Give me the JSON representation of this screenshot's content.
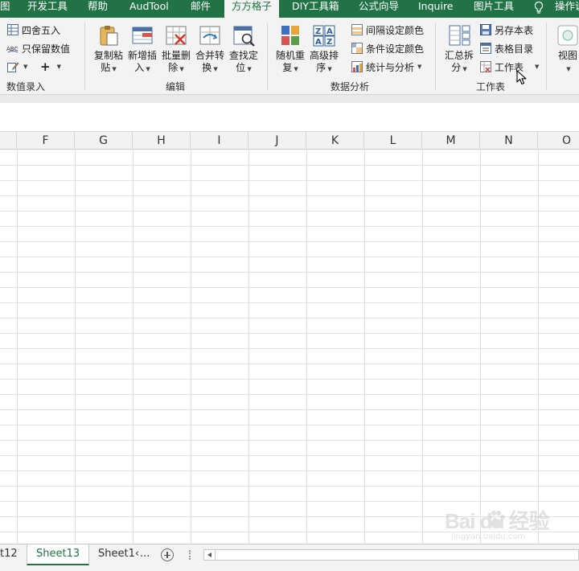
{
  "tabs": [
    {
      "label": "图"
    },
    {
      "label": "开发工具"
    },
    {
      "label": "帮助"
    },
    {
      "label": "AudTool"
    },
    {
      "label": "邮件"
    },
    {
      "label": "方方格子"
    },
    {
      "label": "DIY工具箱"
    },
    {
      "label": "公式向导"
    },
    {
      "label": "Inquire"
    },
    {
      "label": "图片工具"
    },
    {
      "label": "操作说"
    }
  ],
  "ribbon": {
    "input_group": {
      "label": "数值录入",
      "round": "四舍五入",
      "keep_values": "只保留数值",
      "plus": "+"
    },
    "edit_group": {
      "label": "编辑",
      "buttons": [
        {
          "line1": "复制粘",
          "line2": "贴"
        },
        {
          "line1": "新增插",
          "line2": "入"
        },
        {
          "line1": "批量删",
          "line2": "除"
        },
        {
          "line1": "合并转",
          "line2": "换"
        },
        {
          "line1": "查找定",
          "line2": "位"
        }
      ]
    },
    "analysis_group": {
      "label": "数据分析",
      "buttons": [
        {
          "line1": "随机重",
          "line2": "复"
        },
        {
          "line1": "高级排",
          "line2": "序"
        }
      ],
      "interval_color": "间隔设定颜色",
      "cond_color": "条件设定颜色",
      "stats": "统计与分析"
    },
    "sheet_group": {
      "label": "工作表",
      "summary": {
        "line1": "汇总拆",
        "line2": "分"
      },
      "save_as": "另存本表",
      "toc": "表格目录",
      "worksheet": "工作表"
    },
    "view_group": {
      "view": "视图"
    }
  },
  "columns": [
    "F",
    "G",
    "H",
    "I",
    "J",
    "K",
    "L",
    "M",
    "N",
    "O"
  ],
  "sheets": {
    "prev": "t12",
    "active": "Sheet13",
    "next": "Sheet1‹",
    "more": "..."
  },
  "watermark": {
    "main": "Bai du 经验",
    "sub": "jingyan.baidu.com"
  },
  "colors": {
    "accent": "#217346",
    "ribbon_bg": "#f3f3f3",
    "grid_line": "#e1e1e1"
  }
}
